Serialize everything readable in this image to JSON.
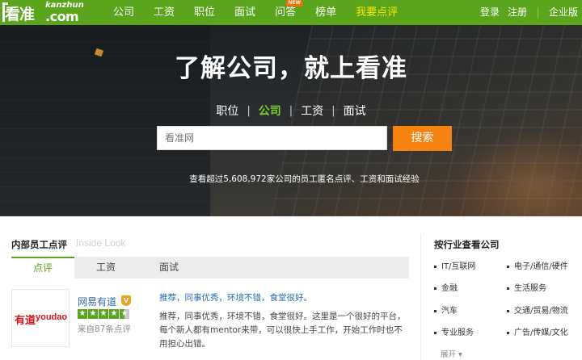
{
  "logo": {
    "brand": "看准",
    "sub": "kanzhun",
    "domain": ".com"
  },
  "nav": {
    "items": [
      "公司",
      "工资",
      "职位",
      "面试",
      "问答",
      "榜单",
      "我要点评"
    ],
    "new_badge": "NEW"
  },
  "account": {
    "login": "登录",
    "register": "注册",
    "enterprise": "企业版"
  },
  "hero": {
    "headline": "了解公司，就上看准",
    "tabs": [
      "职位",
      "公司",
      "工资",
      "面试"
    ],
    "active_tab": "公司",
    "search_placeholder": "看准网",
    "search_button": "搜索",
    "stats": "查看超过5,608,972家公司的员工匿名点评、工资和面试经验"
  },
  "reviews": {
    "title": "内部员工点评",
    "title_en": "Inside Look",
    "tabs": [
      "点评",
      "工资",
      "面试"
    ],
    "company": {
      "logo_cn": "有道",
      "logo_en": "youdao",
      "name": "网易有道",
      "verified": "V",
      "rating": 4.5,
      "count": "来自87条点评",
      "quote": "推荐，同事优秀，环境不错，食堂很好。",
      "review": "推荐，同事优秀，环境不错，食堂很好。这里是一个很好的平台，每个新人都有mentor来带，可以很快上手工作，开始工作时也不用担心出错。"
    }
  },
  "industries": {
    "title": "按行业查看公司",
    "items": [
      "IT/互联网",
      "电子/通信/硬件",
      "金融",
      "生活服务",
      "汽车",
      "交通/贸易/物流",
      "专业服务",
      "广告/传媒/文化"
    ],
    "more": "展开 ▾"
  },
  "colors": {
    "brand_green": "#5aa51b",
    "accent_orange": "#f6820f",
    "link_blue": "#2a6ab0"
  }
}
